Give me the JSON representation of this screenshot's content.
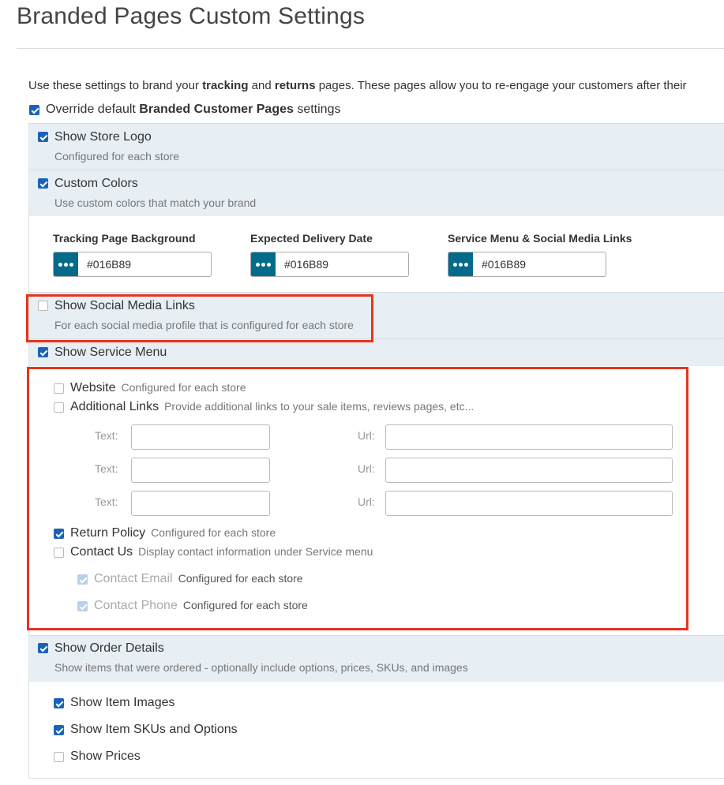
{
  "page": {
    "title": "Branded Pages Custom Settings",
    "intro": {
      "t1": "Use these settings to brand your ",
      "b1": "tracking",
      "t2": " and ",
      "b2": "returns",
      "t3": " pages. These pages allow you to re-engage your customers after their"
    },
    "override": {
      "t1": "Override default ",
      "bold": "Branded Customer Pages",
      "t2": " settings",
      "checked": true
    }
  },
  "sections": {
    "store_logo": {
      "label": "Show Store Logo",
      "desc": "Configured for each store",
      "checked": true
    },
    "custom_colors": {
      "label": "Custom Colors",
      "desc": "Use custom colors that match your brand",
      "checked": true
    },
    "social_media": {
      "label": "Show Social Media Links",
      "desc": "For each social media profile that is configured for each store",
      "checked": false
    },
    "service_menu": {
      "label": "Show Service Menu",
      "checked": true
    },
    "order_details": {
      "label": "Show Order Details",
      "desc": "Show items that were ordered - optionally include options, prices, SKUs, and images",
      "checked": true
    }
  },
  "colors": {
    "tracking_bg": {
      "label": "Tracking Page Background",
      "value": "#016B89"
    },
    "delivery_date": {
      "label": "Expected Delivery Date",
      "value": "#016B89"
    },
    "service_social": {
      "label": "Service Menu & Social Media Links",
      "value": "#016B89"
    },
    "swatch_color": "#016b89"
  },
  "service_menu": {
    "website": {
      "label": "Website",
      "desc": "Configured for each store",
      "checked": false
    },
    "additional_links": {
      "label": "Additional Links",
      "desc": "Provide additional links to your sale items, reviews pages, etc...",
      "checked": false
    },
    "text_label": "Text:",
    "url_label": "Url:",
    "link_rows": [
      {
        "text": "",
        "url": ""
      },
      {
        "text": "",
        "url": ""
      },
      {
        "text": "",
        "url": ""
      }
    ],
    "return_policy": {
      "label": "Return Policy",
      "desc": "Configured for each store",
      "checked": true
    },
    "contact_us": {
      "label": "Contact Us",
      "desc": "Display contact information under Service menu",
      "checked": false
    },
    "contact_email": {
      "label": "Contact Email",
      "desc": "Configured for each store",
      "checked": true,
      "disabled": true
    },
    "contact_phone": {
      "label": "Contact Phone",
      "desc": "Configured for each store",
      "checked": true,
      "disabled": true
    }
  },
  "order_details": {
    "item_images": {
      "label": "Show Item Images",
      "checked": true
    },
    "item_skus": {
      "label": "Show Item SKUs and Options",
      "checked": true
    },
    "prices": {
      "label": "Show Prices",
      "checked": false
    }
  },
  "highlight_color": "#e8331e"
}
